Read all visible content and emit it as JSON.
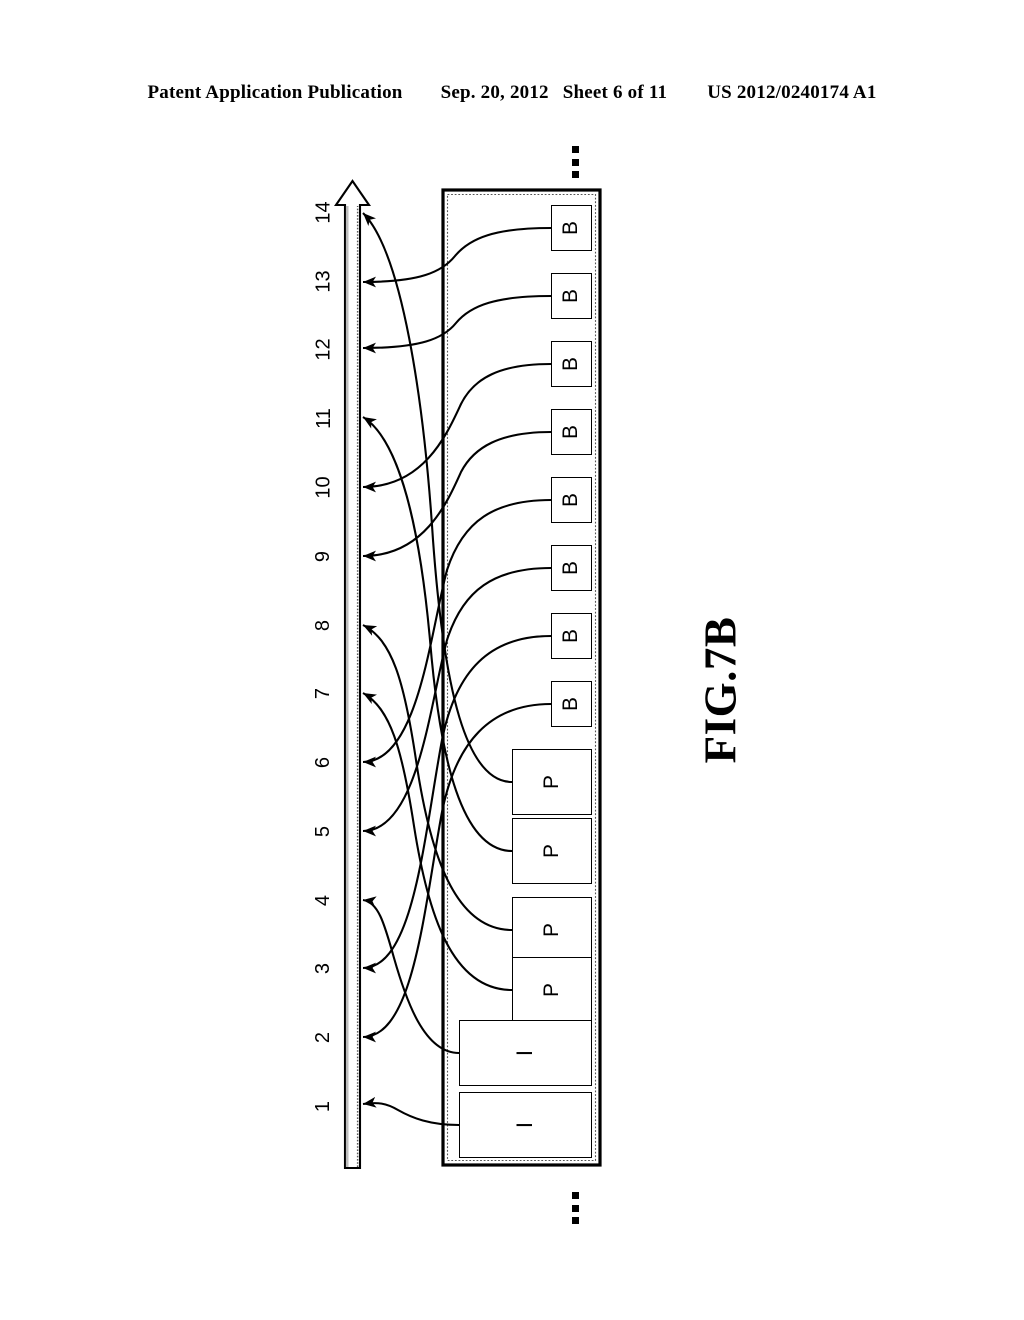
{
  "header": {
    "publication": "Patent Application Publication",
    "date": "Sep. 20, 2012",
    "sheet": "Sheet 6 of 11",
    "patent_number": "US 2012/0240174 A1"
  },
  "figure": {
    "label": "FIG.7B",
    "ellipsis_top": "⋮",
    "ellipsis_bottom": "⋮",
    "timeline": {
      "name": "display-order-axis",
      "direction": "arrow-up",
      "ticks": [
        {
          "index": 1,
          "label": "1"
        },
        {
          "index": 2,
          "label": "2"
        },
        {
          "index": 3,
          "label": "3"
        },
        {
          "index": 4,
          "label": "4"
        },
        {
          "index": 5,
          "label": "5"
        },
        {
          "index": 6,
          "label": "6"
        },
        {
          "index": 7,
          "label": "7"
        },
        {
          "index": 8,
          "label": "8"
        },
        {
          "index": 9,
          "label": "9"
        },
        {
          "index": 10,
          "label": "10"
        },
        {
          "index": 11,
          "label": "11"
        },
        {
          "index": 12,
          "label": "12"
        },
        {
          "index": 13,
          "label": "13"
        },
        {
          "index": 14,
          "label": "14"
        }
      ]
    },
    "frames": [
      {
        "slot": 1,
        "label": "I",
        "type": "I",
        "target_tick": 1
      },
      {
        "slot": 2,
        "label": "I",
        "type": "I",
        "target_tick": 4
      },
      {
        "slot": 3,
        "label": "P",
        "type": "P",
        "target_tick": 7
      },
      {
        "slot": 4,
        "label": "P",
        "type": "P",
        "target_tick": 8
      },
      {
        "slot": 5,
        "label": "P",
        "type": "P",
        "target_tick": 11
      },
      {
        "slot": 6,
        "label": "P",
        "type": "P",
        "target_tick": 14
      },
      {
        "slot": 7,
        "label": "B",
        "type": "B",
        "target_tick": 2
      },
      {
        "slot": 8,
        "label": "B",
        "type": "B",
        "target_tick": 3
      },
      {
        "slot": 9,
        "label": "B",
        "type": "B",
        "target_tick": 5
      },
      {
        "slot": 10,
        "label": "B",
        "type": "B",
        "target_tick": 6
      },
      {
        "slot": 11,
        "label": "B",
        "type": "B",
        "target_tick": 9
      },
      {
        "slot": 12,
        "label": "B",
        "type": "B",
        "target_tick": 10
      },
      {
        "slot": 13,
        "label": "B",
        "type": "B",
        "target_tick": 12
      },
      {
        "slot": 14,
        "label": "B",
        "type": "B",
        "target_tick": 13
      }
    ]
  }
}
